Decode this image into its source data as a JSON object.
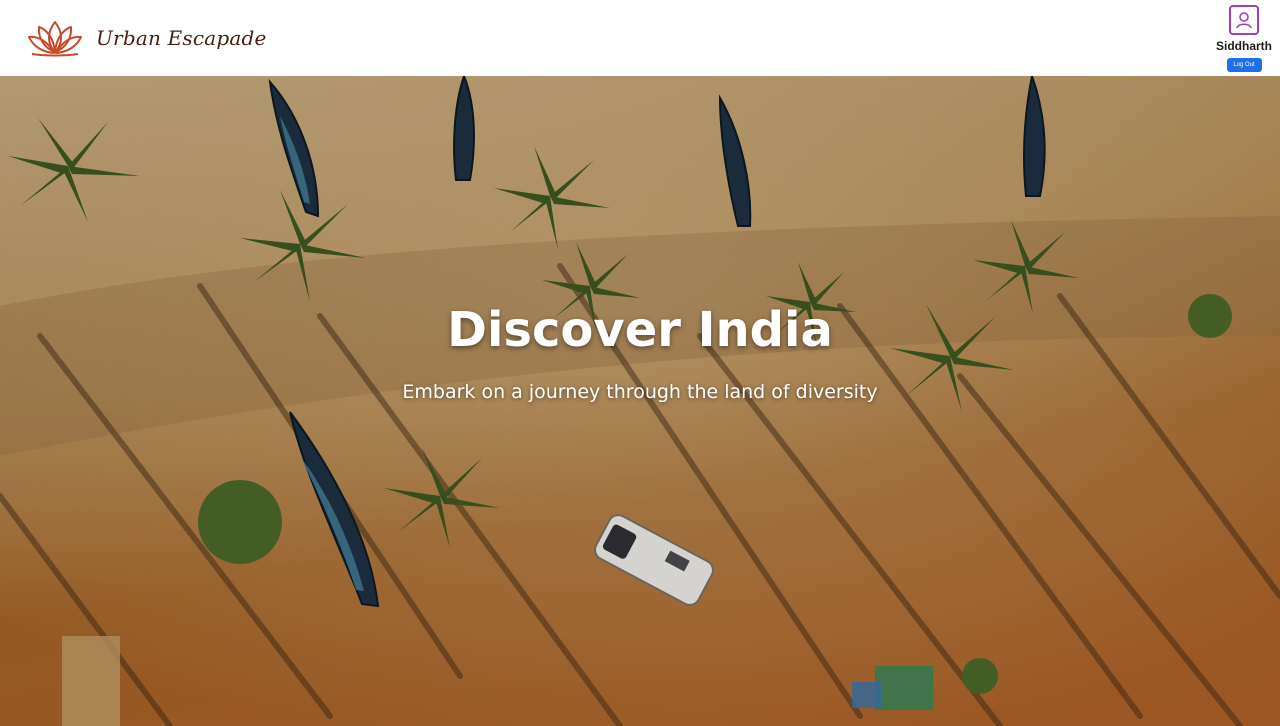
{
  "brand": {
    "name": "Urban Escapade",
    "logo_icon": "lotus-icon",
    "color": "#4a1f12",
    "logo_color": "#c8492a"
  },
  "user": {
    "name": "Siddharth",
    "avatar_icon": "user-profile-icon",
    "logout_label": "Log Out",
    "accent": "#a23fb8",
    "button_color": "#1e6fe8"
  },
  "hero": {
    "title": "Discover India",
    "subtitle": "Embark on a journey through the land of diversity",
    "image_subject": "aerial-beach-photo"
  }
}
